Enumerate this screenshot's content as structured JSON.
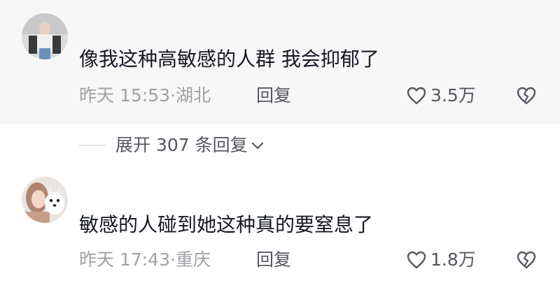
{
  "comments": [
    {
      "text": "像我这种高敏感的人群 我会抑郁了",
      "time_location": "昨天 15:53·湖北",
      "reply_label": "回复",
      "like_count": "3.5万"
    },
    {
      "text": "敏感的人碰到她这种真的要窒息了",
      "time_location": "昨天 17:43·重庆",
      "reply_label": "回复",
      "like_count": "1.8万"
    }
  ],
  "expand_replies": {
    "label": "展开 307 条回复"
  },
  "colors": {
    "highlight_bg": "#f7f7f7",
    "meta": "#a1a1a6",
    "action": "#555760",
    "text": "#161823"
  }
}
